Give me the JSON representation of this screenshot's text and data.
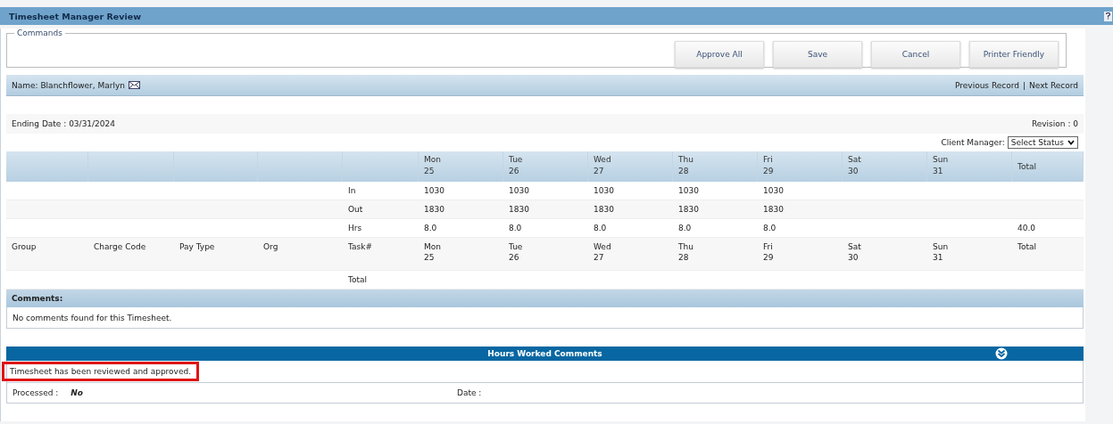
{
  "title": "Timesheet Manager Review",
  "commands": {
    "legend": "Commands",
    "buttons": [
      "Approve All",
      "Save",
      "Cancel",
      "Printer Friendly"
    ]
  },
  "record": {
    "name": "Name: Blanchflower, Marlyn",
    "previous": "Previous Record",
    "separator": "|",
    "next": "Next Record"
  },
  "ending_date": "Ending Date : 03/31/2024",
  "revision": "Revision : 0",
  "client_manager": {
    "label": "Client Manager:",
    "select": "Select Status"
  },
  "table": {
    "days": [
      {
        "day": "Mon",
        "date": "25"
      },
      {
        "day": "Tue",
        "date": "26"
      },
      {
        "day": "Wed",
        "date": "27"
      },
      {
        "day": "Thu",
        "date": "28"
      },
      {
        "day": "Fri",
        "date": "29"
      },
      {
        "day": "Sat",
        "date": "30"
      },
      {
        "day": "Sun",
        "date": "31"
      }
    ],
    "total_heading": "Total",
    "rows": [
      {
        "label": "In",
        "values": [
          "1030",
          "1030",
          "1030",
          "1030",
          "1030"
        ]
      },
      {
        "label": "Out",
        "values": [
          "1830",
          "1830",
          "1830",
          "1830",
          "1830"
        ]
      },
      {
        "label": "Hrs",
        "values": [
          "8.0",
          "8.0",
          "8.0",
          "8.0",
          "8.0"
        ],
        "total": "40.0"
      }
    ],
    "columns": [
      "Group",
      "Charge Code",
      "Pay Type",
      "Org",
      "Task#"
    ],
    "sub_days": [
      {
        "day": "Mon",
        "date": "25"
      },
      {
        "day": "Tue",
        "date": "26"
      },
      {
        "day": "Wed",
        "date": "27"
      },
      {
        "day": "Thu",
        "date": "28"
      },
      {
        "day": "Fri",
        "date": "29"
      },
      {
        "day": "Sat",
        "date": "30"
      },
      {
        "day": "Sun",
        "date": "31"
      }
    ],
    "sub_total": "Total",
    "total_row": "Total"
  },
  "comments": {
    "title": "Comments:",
    "text": "No comments found for this Timesheet."
  },
  "hours_worked": {
    "title": "Hours Worked Comments",
    "text": "Timesheet has been reviewed and approved.",
    "processed_label": "Processed :",
    "processed_value": "No",
    "date_label": "Date :"
  }
}
